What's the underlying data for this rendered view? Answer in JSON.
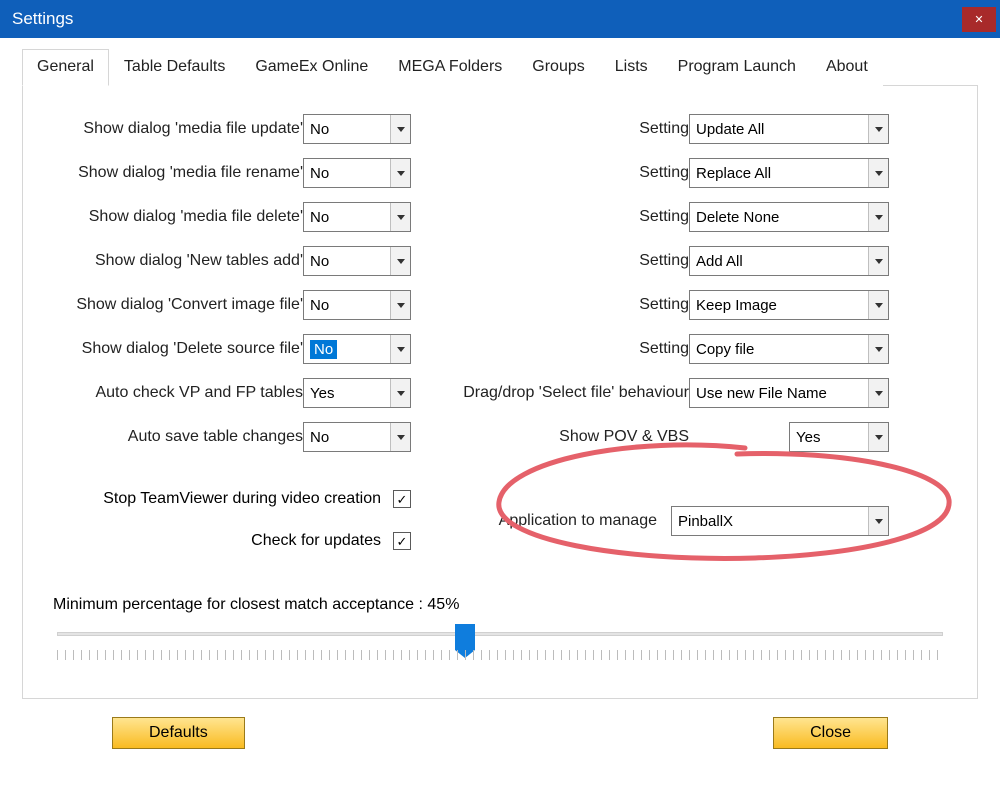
{
  "window": {
    "title": "Settings"
  },
  "tabs": [
    "General",
    "Table Defaults",
    "GameEx Online",
    "MEGA Folders",
    "Groups",
    "Lists",
    "Program Launch",
    "About"
  ],
  "left_rows": [
    {
      "label": "Show dialog 'media file update'",
      "value": "No"
    },
    {
      "label": "Show dialog 'media file rename'",
      "value": "No"
    },
    {
      "label": "Show dialog 'media file delete'",
      "value": "No"
    },
    {
      "label": "Show dialog 'New tables add'",
      "value": "No"
    },
    {
      "label": "Show dialog 'Convert image file'",
      "value": "No"
    },
    {
      "label": "Show dialog 'Delete source file'",
      "value": "No",
      "selected": true
    },
    {
      "label": "Auto check VP and FP tables",
      "value": "Yes"
    },
    {
      "label": "Auto save table changes",
      "value": "No"
    }
  ],
  "right_rows": [
    {
      "label": "Setting",
      "value": "Update All"
    },
    {
      "label": "Setting",
      "value": "Replace All"
    },
    {
      "label": "Setting",
      "value": "Delete None"
    },
    {
      "label": "Setting",
      "value": "Add All"
    },
    {
      "label": "Setting",
      "value": "Keep Image"
    },
    {
      "label": "Setting",
      "value": "Copy file"
    },
    {
      "label": "Drag/drop 'Select file' behaviour",
      "value": "Use new File Name"
    },
    {
      "label": "Show POV & VBS",
      "value": "Yes",
      "narrow": true
    }
  ],
  "checks": {
    "teamviewer": "Stop TeamViewer during video creation",
    "updates": "Check for updates"
  },
  "app_to_manage": {
    "label": "Application to manage",
    "value": "PinballX"
  },
  "slider": {
    "label_prefix": "Minimum percentage for closest match acceptance : ",
    "value": 45,
    "suffix": "%"
  },
  "buttons": {
    "defaults": "Defaults",
    "close": "Close"
  }
}
